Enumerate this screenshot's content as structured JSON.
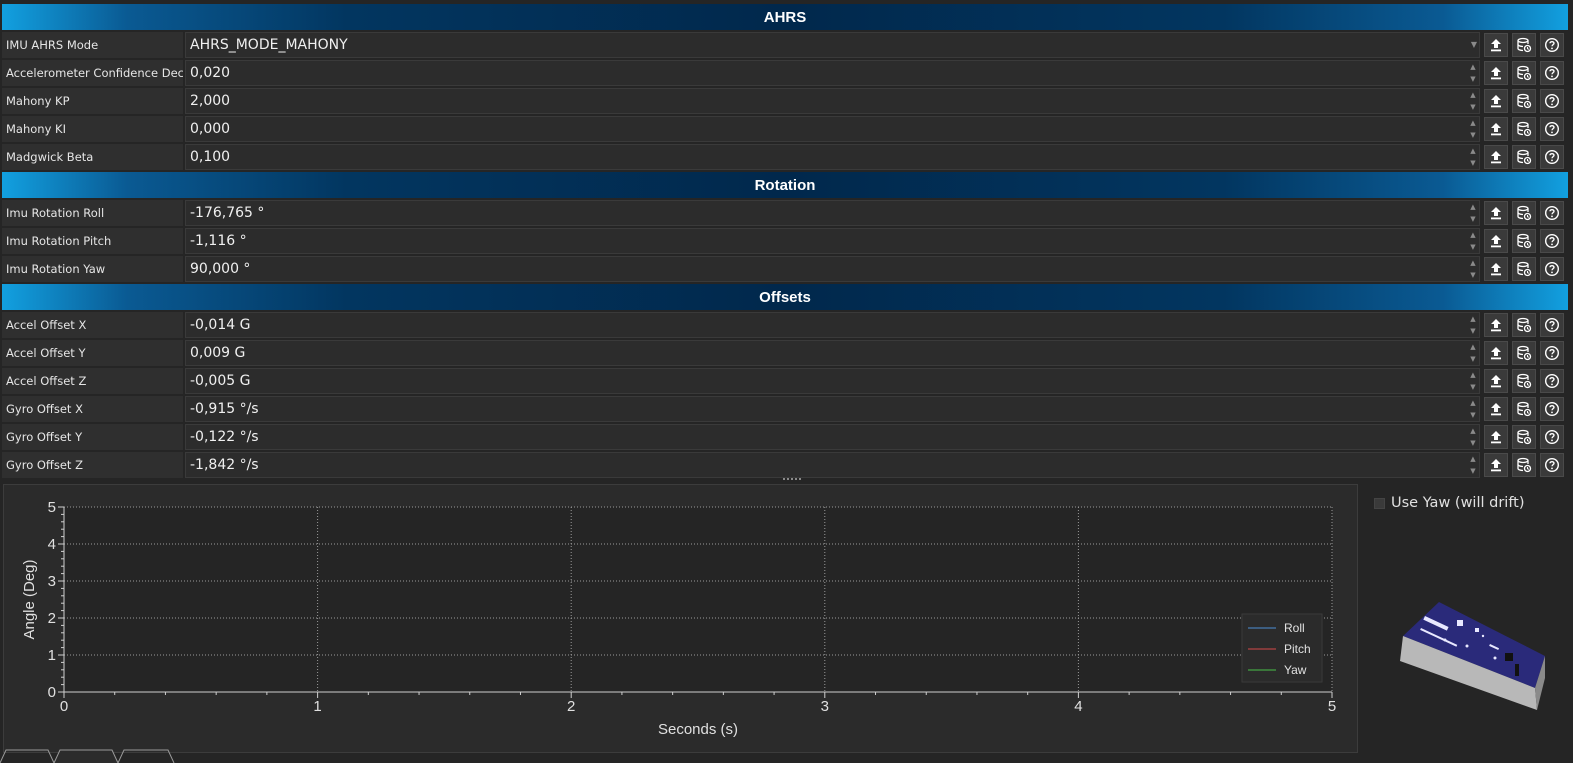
{
  "sections": [
    {
      "title": "AHRS",
      "rows": [
        {
          "label": "IMU AHRS Mode",
          "value": "AHRS_MODE_MAHONY",
          "kind": "dropdown"
        },
        {
          "label": "Accelerometer Confidence Decay",
          "value": "0,020",
          "kind": "spin"
        },
        {
          "label": "Mahony KP",
          "value": "2,000",
          "kind": "spin"
        },
        {
          "label": "Mahony KI",
          "value": "0,000",
          "kind": "spin"
        },
        {
          "label": "Madgwick Beta",
          "value": "0,100",
          "kind": "spin"
        }
      ]
    },
    {
      "title": "Rotation",
      "rows": [
        {
          "label": "Imu Rotation Roll",
          "value": "-176,765 °",
          "kind": "spin"
        },
        {
          "label": "Imu Rotation Pitch",
          "value": "-1,116 °",
          "kind": "spin"
        },
        {
          "label": "Imu Rotation Yaw",
          "value": "90,000 °",
          "kind": "spin"
        }
      ]
    },
    {
      "title": "Offsets",
      "rows": [
        {
          "label": "Accel Offset X",
          "value": "-0,014 G",
          "kind": "spin"
        },
        {
          "label": "Accel Offset Y",
          "value": "0,009 G",
          "kind": "spin"
        },
        {
          "label": "Accel Offset Z",
          "value": "-0,005 G",
          "kind": "spin"
        },
        {
          "label": "Gyro Offset X",
          "value": "-0,915 °/s",
          "kind": "spin"
        },
        {
          "label": "Gyro Offset Y",
          "value": "-0,122 °/s",
          "kind": "spin"
        },
        {
          "label": "Gyro Offset Z",
          "value": "-1,842 °/s",
          "kind": "spin"
        }
      ]
    }
  ],
  "row_buttons": [
    "upload-icon",
    "database-restore-icon",
    "help-icon"
  ],
  "yaw_toggle": {
    "label": "Use Yaw (will drift)",
    "checked": false
  },
  "colors": {
    "accent": "#0a5a93",
    "header_edge": "#12a0e0",
    "roll": "#4e8fd6",
    "pitch": "#d64a4a",
    "yaw": "#4ac24a"
  },
  "chart_data": {
    "type": "line",
    "xlabel": "Seconds (s)",
    "ylabel": "Angle (Deg)",
    "xlim": [
      0,
      5
    ],
    "ylim": [
      0,
      5
    ],
    "xticks": [
      0,
      1,
      2,
      3,
      4,
      5
    ],
    "yticks": [
      0,
      1,
      2,
      3,
      4,
      5
    ],
    "grid": true,
    "legend_position": "bottom-right",
    "series": [
      {
        "name": "Roll",
        "color": "#4e8fd6",
        "x": [],
        "y": []
      },
      {
        "name": "Pitch",
        "color": "#d64a4a",
        "x": [],
        "y": []
      },
      {
        "name": "Yaw",
        "color": "#4ac24a",
        "x": [],
        "y": []
      }
    ]
  }
}
